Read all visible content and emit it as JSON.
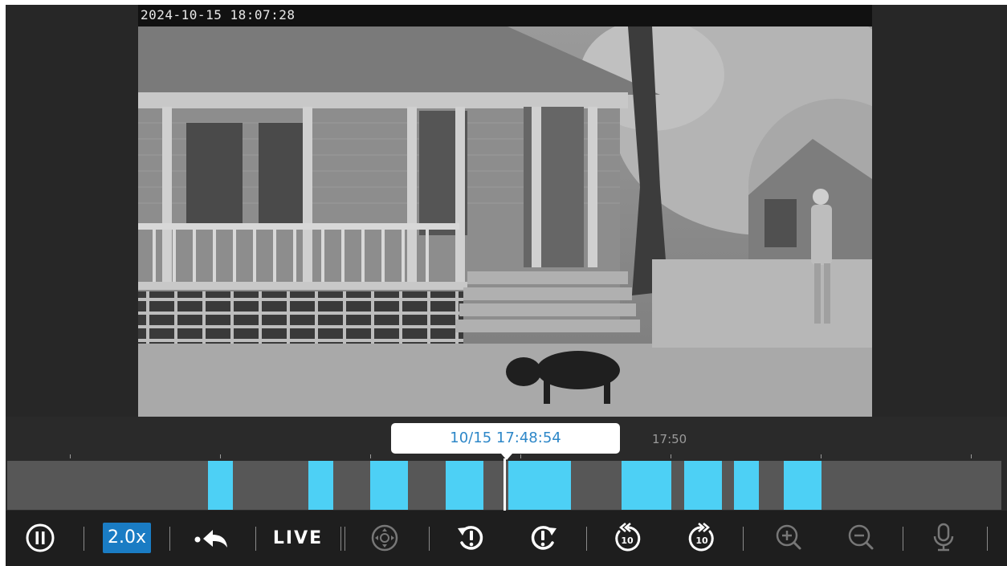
{
  "camera": {
    "osd_timestamp": "2024-10-15 18:07:28"
  },
  "timeline": {
    "hover_time": "10/15 17:48:54",
    "tick_label": "17:50",
    "segment_color": "#4dd0f5"
  },
  "toolbar": {
    "speed_label": "2.0x",
    "live_label": "LIVE",
    "skip_back_label": "10",
    "skip_forward_label": "10",
    "accent_color": "#1a7cc4"
  },
  "icons": [
    "pause-icon",
    "back-to-event-icon",
    "ptz-icon",
    "prev-event-icon",
    "next-event-icon",
    "rewind-10-icon",
    "forward-10-icon",
    "zoom-in-icon",
    "zoom-out-icon",
    "microphone-icon"
  ]
}
